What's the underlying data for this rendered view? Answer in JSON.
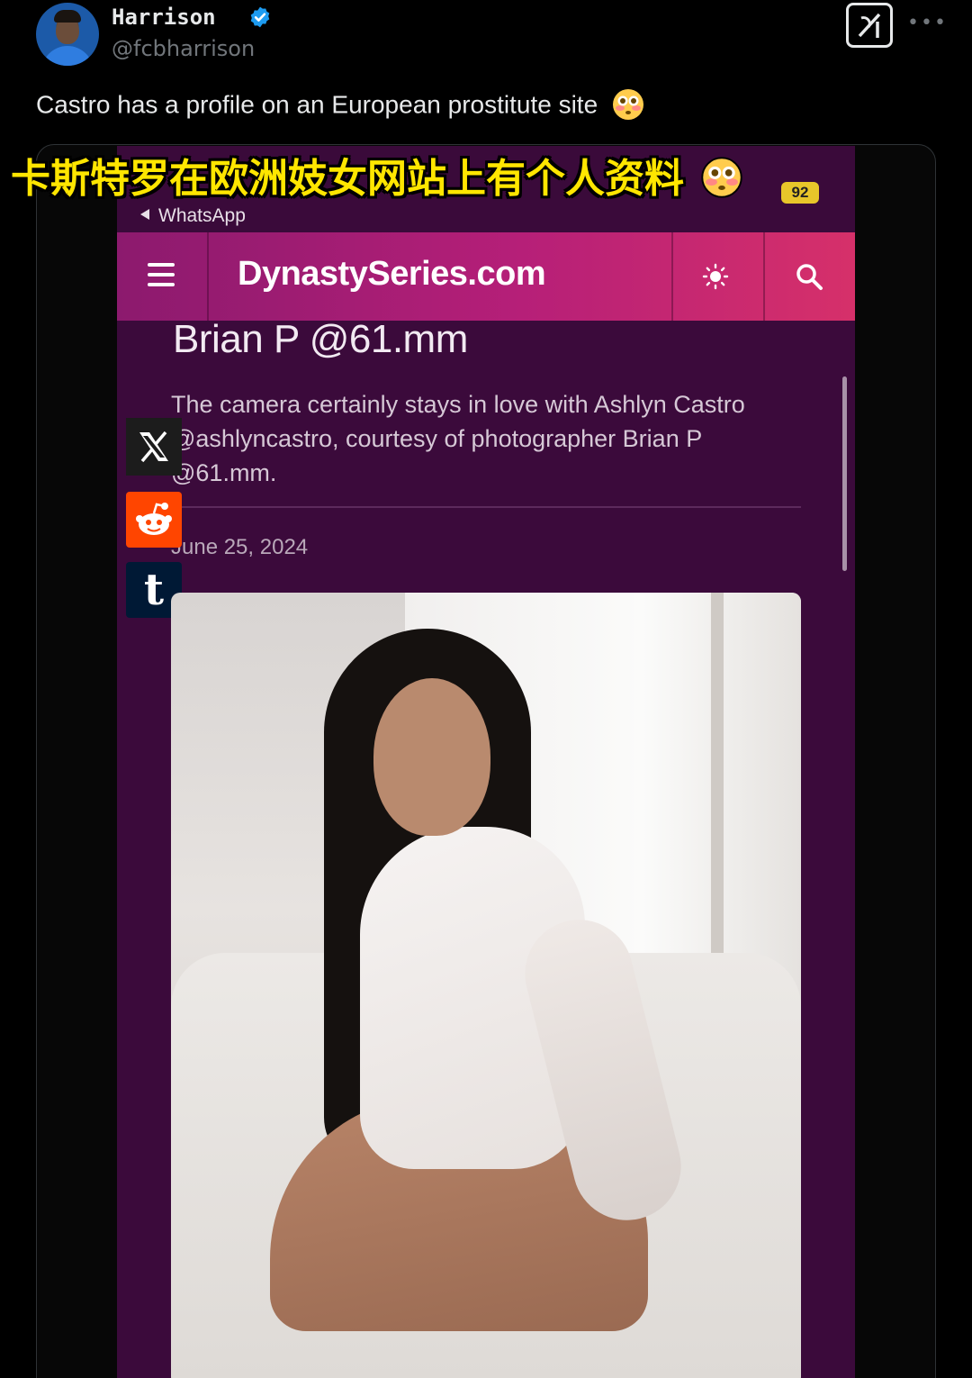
{
  "tweet": {
    "author_name": "Harrison",
    "author_handle": "@fcbharrison",
    "text": "Castro has a profile on an European prostitute site",
    "icons": {
      "verified": "verified-badge-icon",
      "grok": "grok-icon",
      "more": "more-icon",
      "emoji": "flushed-face-emoji"
    }
  },
  "overlay": {
    "caption": "卡斯特罗在欧洲妓女网站上有个人资料"
  },
  "phone": {
    "status": {
      "back_label": "WhatsApp",
      "battery": "92"
    },
    "site": {
      "title": "DynastySeries.com",
      "icons": {
        "menu": "menu-icon",
        "theme": "sun-icon",
        "search": "search-icon"
      }
    },
    "article": {
      "heading": "Brian P @61.mm",
      "body": "The camera certainly stays in love with Ashlyn Castro @ashlyncastro, courtesy of photographer Brian P @61.mm.",
      "date": "June 25, 2024"
    },
    "share": [
      {
        "icon": "x-logo-icon"
      },
      {
        "icon": "reddit-icon"
      },
      {
        "icon": "tumblr-icon",
        "glyph": "t"
      }
    ]
  },
  "colors": {
    "background": "#000000",
    "site_bar_start": "#8c1a6e",
    "site_bar_end": "#d6306a",
    "page_bg": "#3b0a3b",
    "caption": "#ffe600",
    "verified": "#1d9bf0"
  }
}
